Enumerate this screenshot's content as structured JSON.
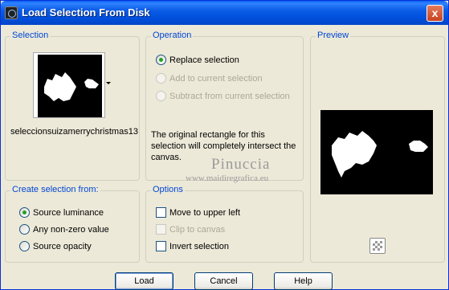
{
  "window": {
    "title": "Load Selection From Disk",
    "close_label": "x"
  },
  "selection_group": {
    "title": "Selection",
    "file_name": "seleccionsuizamerrychristmas13"
  },
  "operation_group": {
    "title": "Operation",
    "options": [
      {
        "label": "Replace selection",
        "selected": true,
        "enabled": true
      },
      {
        "label": "Add to current selection",
        "selected": false,
        "enabled": false
      },
      {
        "label": "Subtract from current selection",
        "selected": false,
        "enabled": false
      }
    ],
    "info_text": "The original rectangle for this selection will completely intersect the canvas."
  },
  "preview_group": {
    "title": "Preview"
  },
  "create_group": {
    "title": "Create selection from:",
    "options": [
      {
        "label": "Source luminance",
        "selected": true
      },
      {
        "label": "Any non-zero value",
        "selected": false
      },
      {
        "label": "Source opacity",
        "selected": false
      }
    ]
  },
  "options_group": {
    "title": "Options",
    "checks": [
      {
        "label": "Move to upper left",
        "checked": false,
        "enabled": true
      },
      {
        "label": "Clip to canvas",
        "checked": false,
        "enabled": false
      },
      {
        "label": "Invert selection",
        "checked": false,
        "enabled": true
      }
    ]
  },
  "watermark": {
    "name": "Pinuccia",
    "url": "www.maidiregrafica.eu"
  },
  "buttons": {
    "load": "Load",
    "cancel": "Cancel",
    "help": "Help"
  }
}
